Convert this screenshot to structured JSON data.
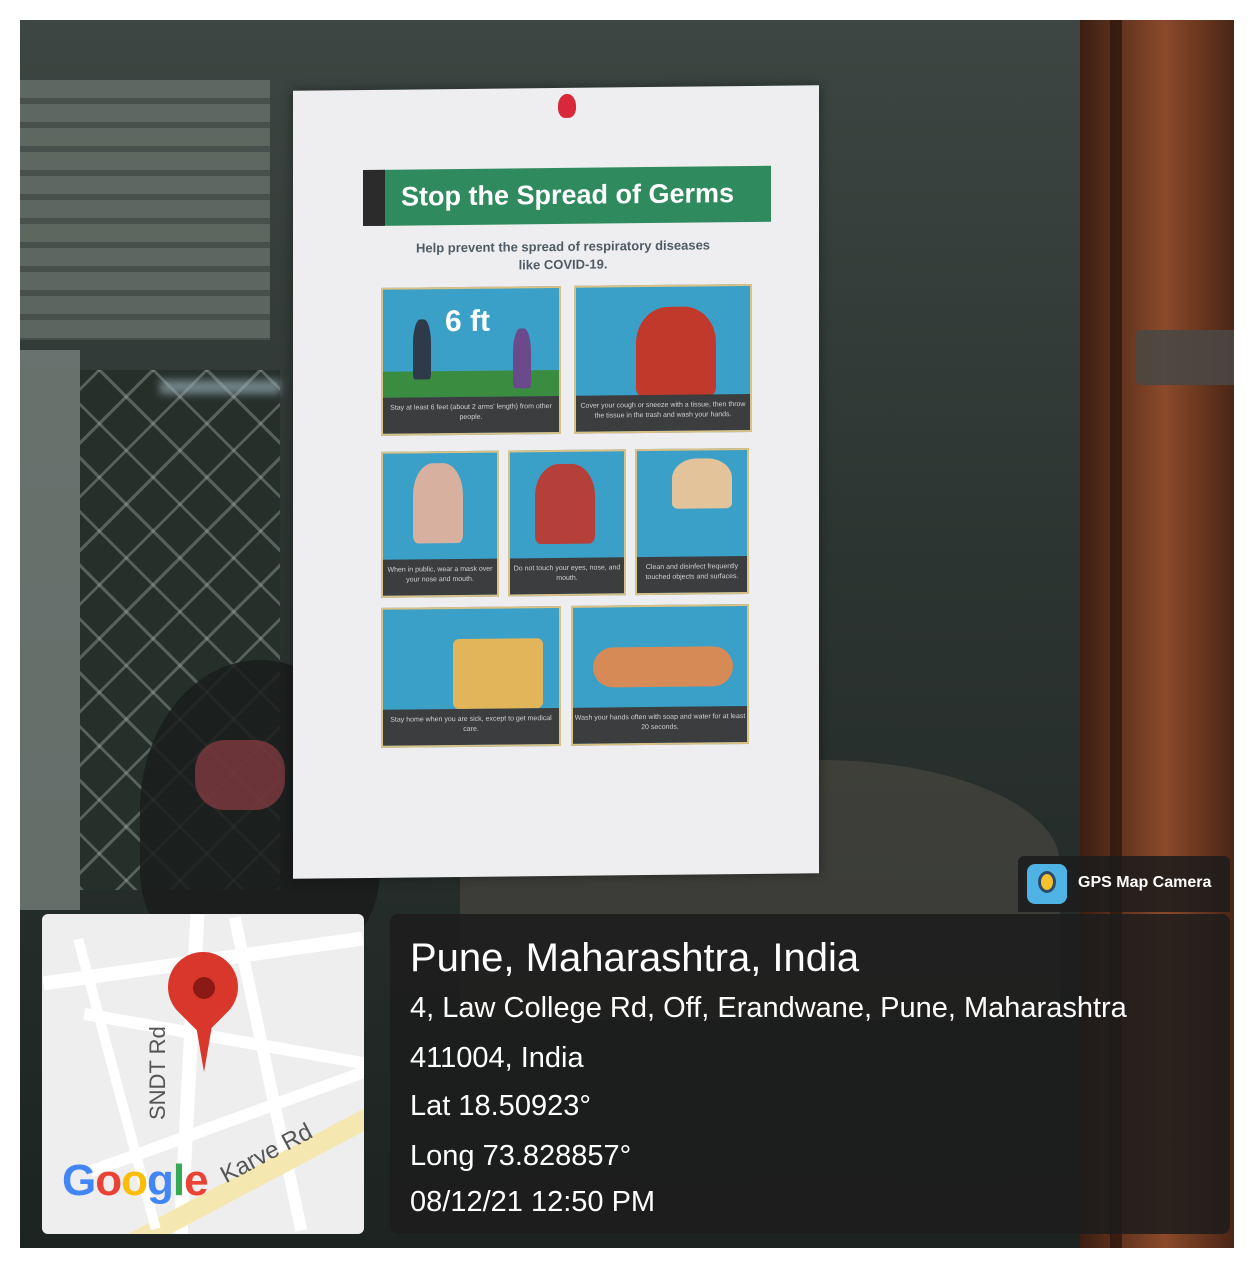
{
  "poster": {
    "title": "Stop the Spread of Germs",
    "subtitle": "Help prevent the spread of respiratory diseases like COVID-19.",
    "distance_label": "6 ft",
    "panels": [
      {
        "caption": "Stay at least 6 feet (about 2 arms' length) from other people."
      },
      {
        "caption": "Cover your cough or sneeze with a tissue, then throw the tissue in the trash and wash your hands."
      },
      {
        "caption": "When in public, wear a mask over your nose and mouth."
      },
      {
        "caption": "Do not touch your eyes, nose, and mouth."
      },
      {
        "caption": "Clean and disinfect frequently touched objects and surfaces."
      },
      {
        "caption": "Stay home when you are sick, except to get medical care."
      },
      {
        "caption": "Wash your hands often with soap and water for at least 20 seconds."
      }
    ]
  },
  "badge": {
    "app_name": "GPS Map Camera",
    "icon": "gps-map-camera-icon"
  },
  "map": {
    "road_labels": [
      "SNDT Rd",
      "Karve Rd"
    ],
    "logo": "Google",
    "pin_color": "#d9372c"
  },
  "location": {
    "title": "Pune, Maharashtra, India",
    "address_line1": "4, Law College Rd, Off, Erandwane, Pune, Maharashtra",
    "address_line2": "411004, India",
    "lat": "Lat 18.50923°",
    "long": "Long 73.828857°",
    "datetime": "08/12/21 12:50 PM"
  }
}
